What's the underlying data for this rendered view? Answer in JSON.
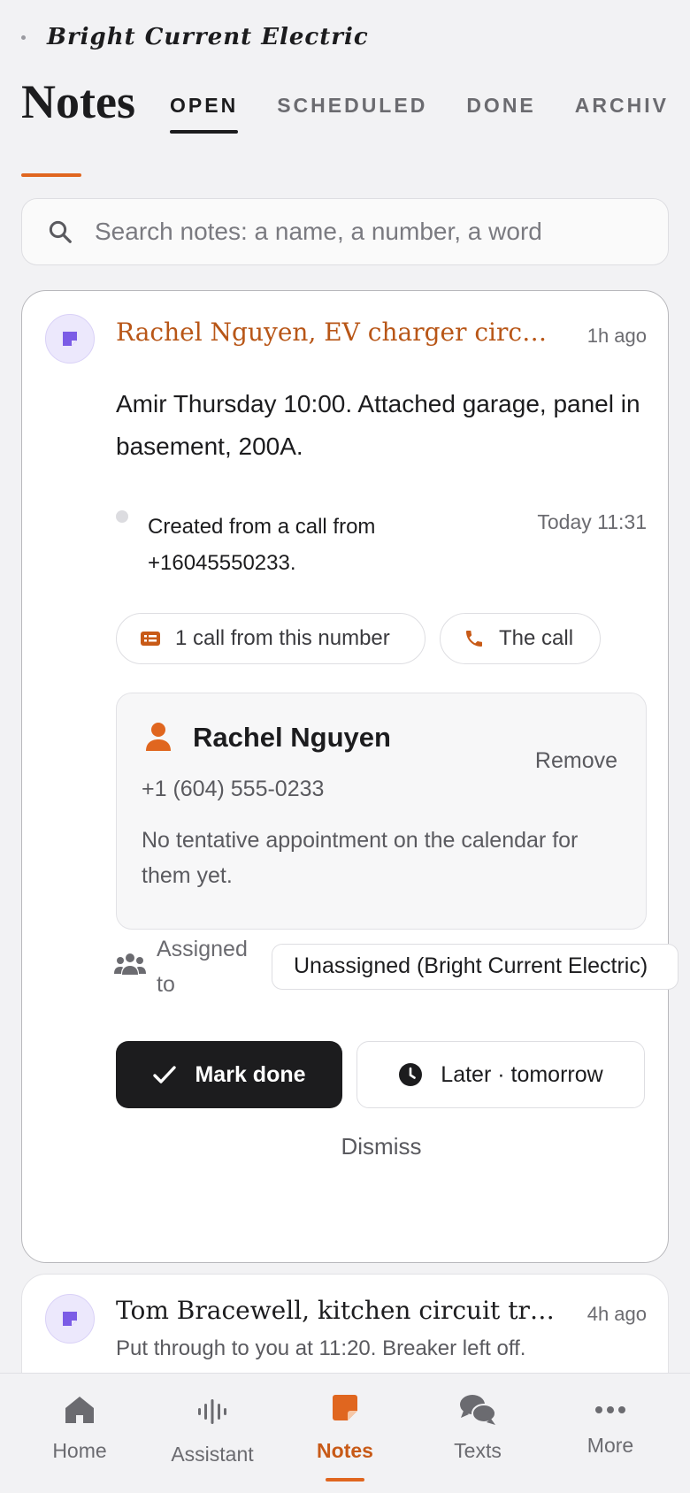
{
  "brand": {
    "name": "Bright Current Electric"
  },
  "page": {
    "title": "Notes"
  },
  "tabs": [
    {
      "label": "OPEN",
      "active": true
    },
    {
      "label": "SCHEDULED",
      "active": false
    },
    {
      "label": "DONE",
      "active": false
    },
    {
      "label": "ARCHIV",
      "active": false
    }
  ],
  "search": {
    "placeholder": "Search notes: a name, a number, a word",
    "value": ""
  },
  "notes": [
    {
      "title": "Rachel Nguyen, EV charger circuit...",
      "time": "1h ago",
      "body": "Amir Thursday 10:00. Attached garage, panel in basement, 200A.",
      "event": {
        "text": "Created from a call from +16045550233.",
        "time": "Today 11:31"
      },
      "chips": [
        {
          "label": "1 call from this number",
          "icon": "call-log-icon"
        },
        {
          "label": "The call",
          "icon": "phone-icon"
        }
      ],
      "contact": {
        "name": "Rachel Nguyen",
        "phone": "+1 (604) 555-0233",
        "note": "No tentative appointment on the calendar for them yet.",
        "remove_label": "Remove"
      },
      "assigned": {
        "label": "Assigned to",
        "value": "Unassigned (Bright Current Electric)"
      },
      "actions": {
        "done_label": "Mark done",
        "later_label": "Later · tomorrow",
        "dismiss_label": "Dismiss"
      }
    },
    {
      "title": "Tom Bracewell, kitchen circuit tri...",
      "time": "4h ago",
      "preview": "Put through to you at 11:20. Breaker left off."
    }
  ],
  "nav": [
    {
      "label": "Home",
      "icon": "home-icon",
      "active": false
    },
    {
      "label": "Assistant",
      "icon": "waveform-icon",
      "active": false
    },
    {
      "label": "Notes",
      "icon": "note-icon",
      "active": true
    },
    {
      "label": "Texts",
      "icon": "chat-bubbles-icon",
      "active": false
    },
    {
      "label": "More",
      "icon": "more-dots-icon",
      "active": false
    }
  ],
  "colors": {
    "accent": "#e0661f",
    "note_title": "#b85617",
    "note_badge": "#7b5ce6",
    "dark_button": "#1c1c1e",
    "background": "#f2f2f4"
  }
}
